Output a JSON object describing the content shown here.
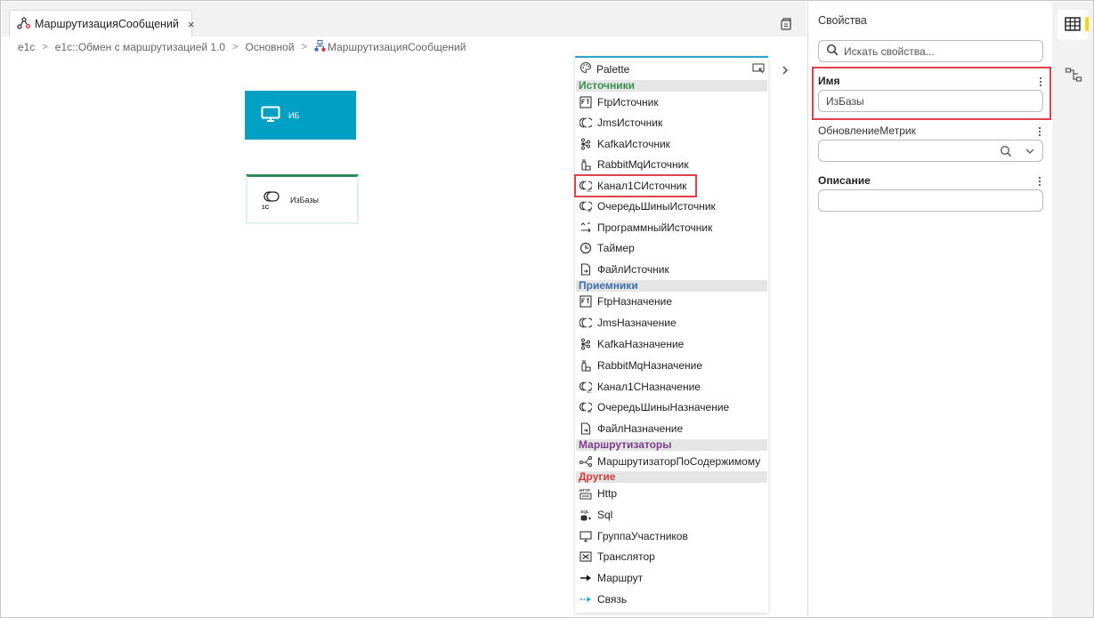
{
  "tab": {
    "label": "МаршрутизацияСообщений",
    "close": "×"
  },
  "breadcrumb": [
    "e1c",
    "e1c::Обмен с маршрутизацией 1.0",
    "Основной",
    "МаршрутизацияСообщений"
  ],
  "nodes": {
    "ib_label": "ИБ",
    "izbazy_label": "ИзБазы",
    "izbazy_logo_text": "1C"
  },
  "palette": {
    "title": "Palette",
    "sections": {
      "sources": "Источники",
      "receivers": "Приемники",
      "routers": "Маршрутизаторы",
      "other": "Другие"
    },
    "sources": [
      "FtpИсточник",
      "JmsИсточник",
      "KafkaИсточник",
      "RabbitMqИсточник",
      "Канал1СИсточник",
      "ОчередьШиныИсточник",
      "ПрограммныйИсточник",
      "Таймер",
      "ФайлИсточник"
    ],
    "receivers": [
      "FtpНазначение",
      "JmsНазначение",
      "KafkaНазначение",
      "RabbitMqНазначение",
      "Канал1СНазначение",
      "ОчередьШиныНазначение",
      "ФайлНазначение"
    ],
    "routers": [
      "МаршрутизаторПоСодержимому"
    ],
    "other": [
      "Http",
      "Sql",
      "ГруппаУчастников",
      "Транслятор",
      "Маршрут",
      "Связь"
    ]
  },
  "properties": {
    "title": "Свойства",
    "search_placeholder": "Искать свойства...",
    "name_label": "Имя",
    "name_value": "ИзБазы",
    "metrics_label": "ОбновлениеМетрик",
    "metrics_value": "",
    "description_label": "Описание",
    "description_value": ""
  },
  "colors": {
    "ib_node": "#009fc4",
    "highlight": "#e0404a",
    "sources": "#3a8f52",
    "receivers": "#3f6fa7",
    "routers": "#7b3d8c",
    "other": "#d23b3b"
  }
}
